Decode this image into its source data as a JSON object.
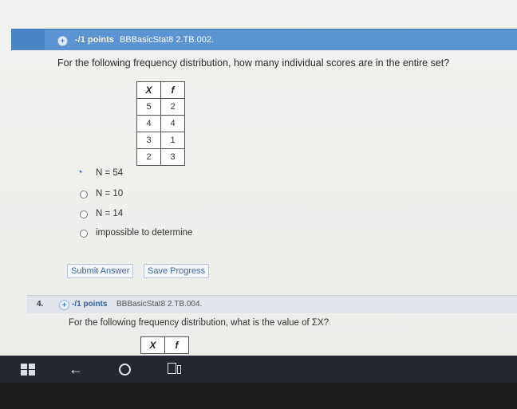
{
  "question3": {
    "header": {
      "points": "-/1 points",
      "code": "BBBasicStat8 2.TB.002."
    },
    "text": "For the following frequency distribution, how many individual scores are in the entire set?",
    "table": {
      "headers": [
        "X",
        "f"
      ],
      "rows": [
        [
          "5",
          "2"
        ],
        [
          "4",
          "4"
        ],
        [
          "3",
          "1"
        ],
        [
          "2",
          "3"
        ]
      ]
    },
    "options": [
      {
        "label": "N = 54",
        "selected": true
      },
      {
        "label": "N = 10",
        "selected": false
      },
      {
        "label": "N = 14",
        "selected": false
      },
      {
        "label": "impossible to determine",
        "selected": false
      }
    ],
    "submit_label": "Submit Answer",
    "save_label": "Save Progress"
  },
  "question4": {
    "number": "4.",
    "header": {
      "points": "-/1 points",
      "code": "BBBasicStat8 2.TB.004."
    },
    "text": "For the following frequency distribution, what is the value of ΣX?",
    "table": {
      "headers": [
        "X",
        "f"
      ]
    }
  },
  "taskbar": {
    "items": [
      "windows-start-icon",
      "back-arrow-icon",
      "cortana-circle-icon",
      "task-view-icon"
    ],
    "back_glyph": "←"
  },
  "colors": {
    "header_blue": "#5b93d3",
    "link_blue": "#3a6aa8",
    "taskbar": "#232734"
  }
}
